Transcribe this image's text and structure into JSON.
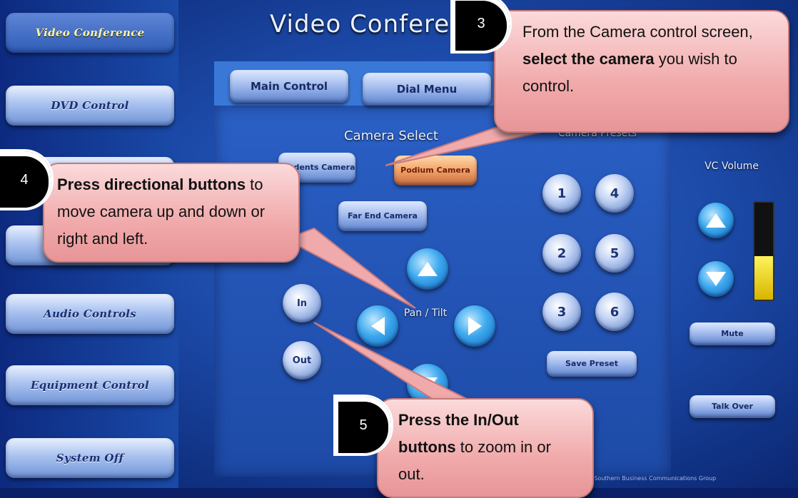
{
  "header": {
    "title": "Video Conferei"
  },
  "sidebar": {
    "items": [
      {
        "label": "Video Conference",
        "active": true
      },
      {
        "label": "DVD Control"
      },
      {
        "label": ""
      },
      {
        "label": ""
      },
      {
        "label": "Audio Controls"
      },
      {
        "label": "Equipment Control"
      },
      {
        "label": "System Off"
      }
    ]
  },
  "tabs": {
    "main_control": "Main Control",
    "dial_menu": "Dial Menu"
  },
  "camera_select": {
    "title": "Camera Select",
    "students": "Students Camera",
    "podium": "Podium Camera",
    "farend": "Far End Camera"
  },
  "pan_tilt": {
    "label": "Pan / Tilt"
  },
  "zoom": {
    "in": "In",
    "out": "Out"
  },
  "presets": {
    "title": "Camera Presets",
    "buttons": [
      "1",
      "4",
      "2",
      "5",
      "3",
      "6"
    ],
    "save": "Save Preset"
  },
  "volume": {
    "title": "VC Volume",
    "mute": "Mute",
    "talk_over": "Talk Over",
    "level": 0.45
  },
  "callouts": {
    "c3": {
      "num": "3",
      "text_pre": "From the Camera control screen, ",
      "text_bold": "select the camera",
      "text_post": " you wish to control."
    },
    "c4": {
      "num": "4",
      "text_bold": "Press directional buttons",
      "text_post": " to move camera up and down or right and left."
    },
    "c5": {
      "num": "5",
      "text_bold": "Press the In/Out buttons",
      "text_post": " to zoom in or out."
    }
  },
  "footer": "by Southern Business Communications Group",
  "colors": {
    "accent": "#f1aaab",
    "volume": "#f0d000"
  }
}
